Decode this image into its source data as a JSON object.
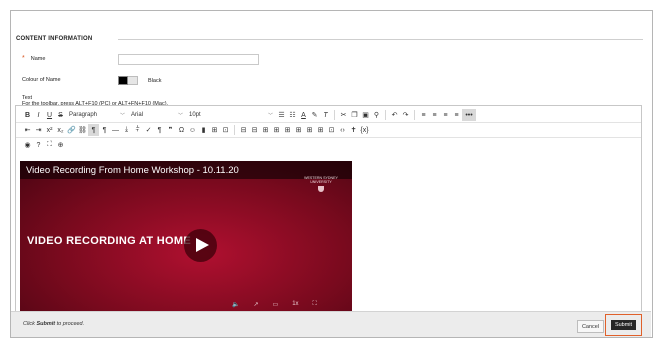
{
  "section": {
    "title": "CONTENT INFORMATION"
  },
  "form": {
    "name_label": "Name",
    "required_mark": "*",
    "name_value": "",
    "colour_label": "Colour of Name",
    "colour_value": "Black",
    "colour_hex": "#000000",
    "text_label": "Text",
    "toolbar_hint": "For the toolbar, press ALT+F10 (PC) or ALT+FN+F10 (Mac)."
  },
  "toolbar": {
    "paragraph": "Paragraph",
    "font": "Arial",
    "size": "10pt"
  },
  "video": {
    "title": "Video Recording From Home Workshop - 10.11.20",
    "university_line1": "WESTERN SYDNEY",
    "university_line2": "UNIVERSITY",
    "overlay_text": "VIDEO RECORDING AT HOME",
    "speed": "1x"
  },
  "footer": {
    "prompt_prefix": "Click",
    "prompt_bold": "Submit",
    "prompt_suffix": "to proceed.",
    "cancel_label": "Cancel",
    "submit_label": "Submit"
  },
  "colors": {
    "accent_outline": "#e0602a",
    "video_red": "#a00e2a"
  }
}
